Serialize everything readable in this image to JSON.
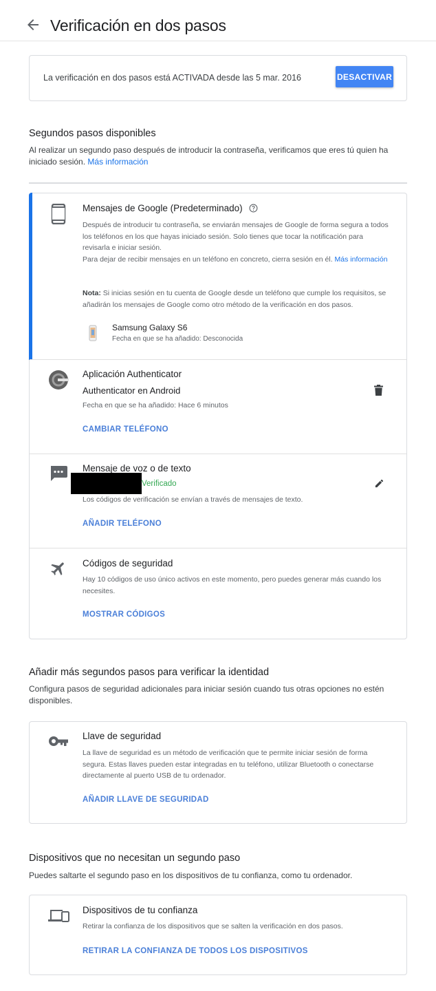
{
  "header": {
    "title": "Verificación en dos pasos"
  },
  "status": {
    "text": "La verificación en dos pasos está ACTIVADA desde las 5 mar. 2016",
    "button": "DESACTIVAR"
  },
  "available": {
    "title": "Segundos pasos disponibles",
    "desc": "Al realizar un segundo paso después de introducir la contraseña, verificamos que eres tú quien ha iniciado sesión.",
    "link": "Más información"
  },
  "google_prompt": {
    "title": "Mensajes de Google (Predeterminado)",
    "line1": "Después de introducir tu contraseña, se enviarán mensajes de Google de forma segura a todos los teléfonos en los que hayas iniciado sesión. Solo tienes que tocar la notificación para revisarla e iniciar sesión.",
    "line2": "Para dejar de recibir mensajes en un teléfono en concreto, cierra sesión en él.",
    "link": "Más información",
    "note_label": "Nota:",
    "note": "Si inicias sesión en tu cuenta de Google desde un teléfono que cumple los requisitos, se añadirán los mensajes de Google como otro método de la verificación en dos pasos.",
    "device_name": "Samsung Galaxy S6",
    "device_date": "Fecha en que se ha añadido: Desconocida"
  },
  "authenticator": {
    "title": "Aplicación Authenticator",
    "sub": "Authenticator en Android",
    "date": "Fecha en que se ha añadido: Hace 6 minutos",
    "action": "CAMBIAR TELÉFONO"
  },
  "voice_sms": {
    "title": "Mensaje de voz o de texto",
    "verified": "Verificado",
    "desc": "Los códigos de verificación se envían a través de mensajes de texto.",
    "action": "AÑADIR TELÉFONO"
  },
  "backup_codes": {
    "title": "Códigos de seguridad",
    "desc": "Hay 10 códigos de uso único activos en este momento, pero puedes generar más cuando los necesites.",
    "action": "MOSTRAR CÓDIGOS"
  },
  "more_steps": {
    "title": "Añadir más segundos pasos para verificar la identidad",
    "desc": "Configura pasos de seguridad adicionales para iniciar sesión cuando tus otras opciones no estén disponibles."
  },
  "security_key": {
    "title": "Llave de seguridad",
    "desc": "La llave de seguridad es un método de verificación que te permite iniciar sesión de forma segura. Estas llaves pueden estar integradas en tu teléfono, utilizar Bluetooth o conectarse directamente al puerto USB de tu ordenador.",
    "action": "AÑADIR LLAVE DE SEGURIDAD"
  },
  "devices": {
    "title": "Dispositivos que no necesitan un segundo paso",
    "desc": "Puedes saltarte el segundo paso en los dispositivos de tu confianza, como tu ordenador."
  },
  "trusted": {
    "title": "Dispositivos de tu confianza",
    "desc": "Retirar la confianza de los dispositivos que se salten la verificación en dos pasos.",
    "action": "RETIRAR LA CONFIANZA DE TODOS LOS DISPOSITIVOS"
  },
  "colors": {
    "accent": "#1a73e8",
    "button": "#4285f4",
    "verified": "#34a853"
  }
}
